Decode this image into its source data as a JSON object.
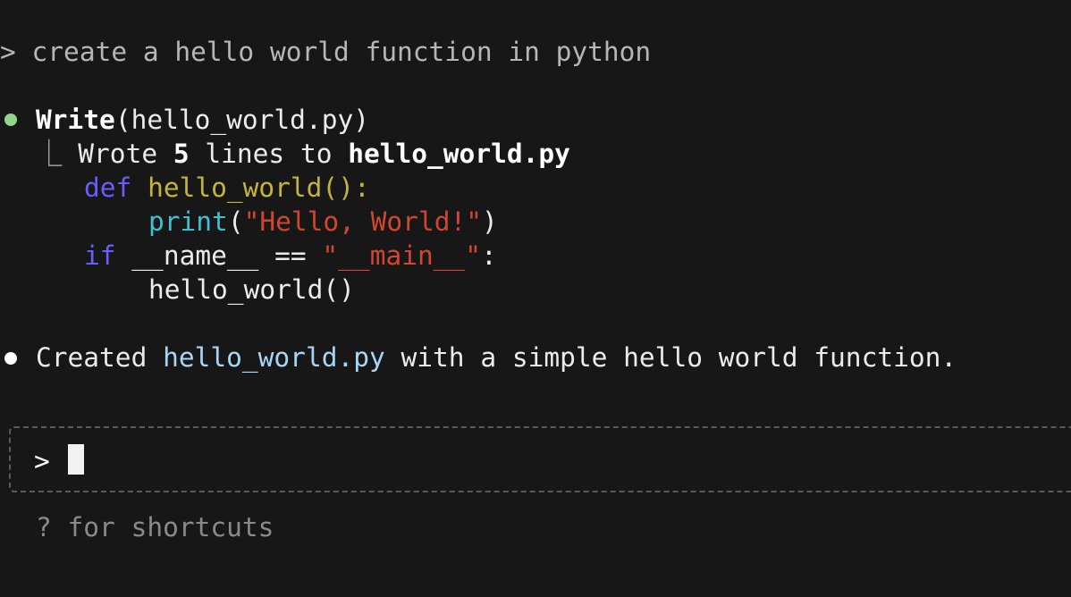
{
  "user_prompt": {
    "marker": ">",
    "text": "create a hello world function in python"
  },
  "tool_call": {
    "name": "Write",
    "args": "(hello_world.py)",
    "result_prefix": "Wrote ",
    "result_count": "5",
    "result_mid": " lines to ",
    "result_file": "hello_world.py",
    "tree_glyph": "⎿"
  },
  "code": {
    "line1": {
      "kw": "def",
      "fn": "hello_world():"
    },
    "line2": {
      "builtin": "print",
      "open": "(",
      "str": "\"Hello, World!\"",
      "close": ")"
    },
    "line3": {
      "kw": "if",
      "mid": " __name__ == ",
      "str": "\"__main__\"",
      "end": ":"
    },
    "line4": {
      "call": "hello_world()"
    }
  },
  "assistant_message": {
    "pre": "Created ",
    "file": "hello_world.py",
    "post": " with a simple hello world function."
  },
  "input": {
    "prompt": ">",
    "value": ""
  },
  "hint": "? for shortcuts",
  "colors": {
    "background": "#171717",
    "status_dot_green": "#8fd68a",
    "keyword": "#6b5cff",
    "function": "#c5b43a",
    "builtin": "#3fc1d3",
    "string": "#d2462f",
    "file_link": "#a9d6f5"
  }
}
